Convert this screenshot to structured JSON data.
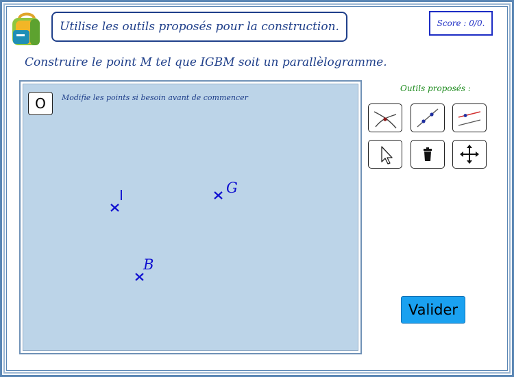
{
  "header": {
    "instruction": "Utilise les outils proposés pour la construction.",
    "score": "Score : 0/0."
  },
  "task": "Construire le point M tel que IGBM soit un parallèlogramme.",
  "canvas": {
    "reset_button_label": "O",
    "hint": "Modifie les points si besoin avant de commencer",
    "points": [
      {
        "label": "I"
      },
      {
        "label": "G"
      },
      {
        "label": "B"
      }
    ]
  },
  "tools": {
    "title": "Outils proposés :",
    "items": [
      {
        "name": "intersection-icon"
      },
      {
        "name": "line-through-points-icon"
      },
      {
        "name": "parallel-line-icon"
      },
      {
        "name": "pointer-icon"
      },
      {
        "name": "trash-icon"
      },
      {
        "name": "move-icon"
      }
    ]
  },
  "actions": {
    "validate_label": "Valider"
  },
  "colors": {
    "primary_text": "#1f3f8a",
    "score_border": "#1c2cc4",
    "tools_title": "#1c8a1c",
    "canvas_bg": "#bcd4e8",
    "point_color": "#1010d0",
    "validate_bg": "#1aa1f0"
  }
}
